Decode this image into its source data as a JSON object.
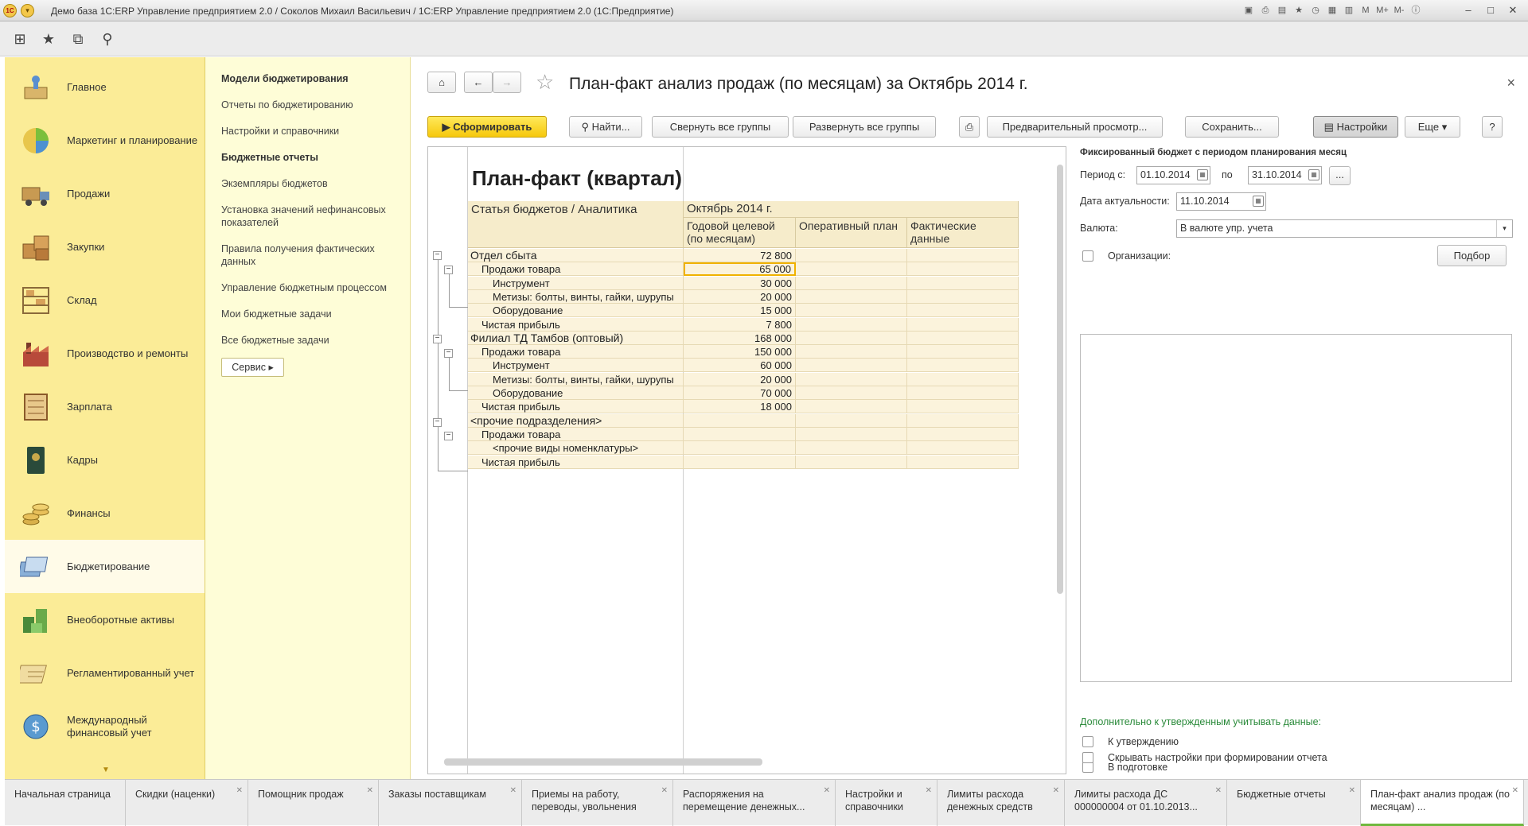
{
  "window": {
    "title": "Демо база 1С:ERP Управление предприятием 2.0 / Соколов Михаил Васильевич / 1С:ERP Управление предприятием 2.0  (1С:Предприятие)",
    "zoom_labels": [
      "M",
      "M+",
      "M-"
    ]
  },
  "sections": [
    {
      "label": "Главное",
      "icon": "home-desk-icon"
    },
    {
      "label": "Маркетинг и планирование",
      "icon": "pie-chart-icon"
    },
    {
      "label": "Продажи",
      "icon": "truck-icon"
    },
    {
      "label": "Закупки",
      "icon": "boxes-icon"
    },
    {
      "label": "Склад",
      "icon": "warehouse-shelf-icon"
    },
    {
      "label": "Производство и ремонты",
      "icon": "factory-icon"
    },
    {
      "label": "Зарплата",
      "icon": "abacus-icon"
    },
    {
      "label": "Кадры",
      "icon": "passport-icon"
    },
    {
      "label": "Финансы",
      "icon": "coins-icon"
    },
    {
      "label": "Бюджетирование",
      "icon": "budget-docs-icon"
    },
    {
      "label": "Внеоборотные активы",
      "icon": "assets-icon"
    },
    {
      "label": "Регламентированный учет",
      "icon": "ledger-icon"
    },
    {
      "label": "Международный финансовый учет",
      "icon": "globe-dollar-icon"
    }
  ],
  "active_section": "Бюджетирование",
  "subnav": {
    "items": [
      {
        "label": "Модели бюджетирования",
        "header": true
      },
      {
        "label": "Отчеты по бюджетированию",
        "header": false
      },
      {
        "label": "Настройки и справочники",
        "header": false
      },
      {
        "label": "Бюджетные отчеты",
        "header": true
      },
      {
        "label": "Экземпляры бюджетов",
        "header": false
      },
      {
        "label": "Установка значений нефинансовых показателей",
        "header": false
      },
      {
        "label": "Правила получения фактических данных",
        "header": false
      },
      {
        "label": "Управление бюджетным процессом",
        "header": false
      },
      {
        "label": "Мои бюджетные задачи",
        "header": false
      },
      {
        "label": "Все бюджетные задачи",
        "header": false
      }
    ],
    "service_label": "Сервис"
  },
  "form": {
    "title": "План-факт анализ продаж (по месяцам)  за Октябрь 2014 г.",
    "buttons": {
      "generate": "Сформировать",
      "find": "Найти...",
      "collapse_all": "Свернуть все группы",
      "expand_all": "Развернуть все группы",
      "preview": "Предварительный просмотр...",
      "save": "Сохранить...",
      "settings": "Настройки",
      "more": "Еще",
      "help": "?"
    }
  },
  "report": {
    "title": "План-факт (квартал)",
    "header": {
      "article": "Статья бюджетов / Аналитика",
      "period": "Октябрь 2014 г.",
      "col_annual": "Годовой целевой (по месяцам)",
      "col_operative": "Оперативный план",
      "col_fact": "Фактические данные"
    },
    "rows": [
      {
        "label": "Отдел сбыта",
        "value": "72 800",
        "level": 0
      },
      {
        "label": "Продажи товара",
        "value": "65 000",
        "level": 1
      },
      {
        "label": "Инструмент",
        "value": "30 000",
        "level": 2
      },
      {
        "label": "Метизы: болты, винты, гайки, шурупы",
        "value": "20 000",
        "level": 2
      },
      {
        "label": "Оборудование",
        "value": "15 000",
        "level": 2
      },
      {
        "label": "Чистая прибыль",
        "value": "7 800",
        "level": 1
      },
      {
        "label": "Филиал ТД Тамбов (оптовый)",
        "value": "168 000",
        "level": 0
      },
      {
        "label": "Продажи товара",
        "value": "150 000",
        "level": 1
      },
      {
        "label": "Инструмент",
        "value": "60 000",
        "level": 2
      },
      {
        "label": "Метизы: болты, винты, гайки, шурупы",
        "value": "20 000",
        "level": 2
      },
      {
        "label": "Оборудование",
        "value": "70 000",
        "level": 2
      },
      {
        "label": "Чистая прибыль",
        "value": "18 000",
        "level": 1
      },
      {
        "label": "<прочие подразделения>",
        "value": "",
        "level": 0
      },
      {
        "label": "Продажи товара",
        "value": "",
        "level": 1
      },
      {
        "label": "<прочие виды номенклатуры>",
        "value": "",
        "level": 2
      },
      {
        "label": "Чистая прибыль",
        "value": "",
        "level": 1
      }
    ]
  },
  "settings": {
    "heading": "Фиксированный бюджет с периодом планирования месяц",
    "period_from_label": "Период с:",
    "period_from": "01.10.2014",
    "period_to_label": "по",
    "period_to": "31.10.2014",
    "period_more": "...",
    "actuality_label": "Дата актуальности:",
    "actuality": "11.10.2014",
    "currency_label": "Валюта:",
    "currency": "В валюте упр. учета",
    "org_label": "Организации:",
    "pick_label": "Подбор",
    "extra_heading": "Дополнительно к утвержденным учитывать данные:",
    "to_approve": "К утверждению",
    "in_prep": "В подготовке",
    "hide_settings": "Скрывать настройки при формировании отчета"
  },
  "tabs": [
    {
      "label": "Начальная страница"
    },
    {
      "label": "Скидки (наценки)"
    },
    {
      "label": "Помощник продаж"
    },
    {
      "label": "Заказы поставщикам"
    },
    {
      "label": "Приемы на работу, переводы, увольнения"
    },
    {
      "label": "Распоряжения на перемещение денежных..."
    },
    {
      "label": "Настройки и справочники"
    },
    {
      "label": "Лимиты расхода денежных средств"
    },
    {
      "label": "Лимиты расхода ДС 000000004 от 01.10.2013..."
    },
    {
      "label": "Бюджетные отчеты"
    },
    {
      "label": "План-факт анализ продаж (по месяцам) ..."
    }
  ]
}
